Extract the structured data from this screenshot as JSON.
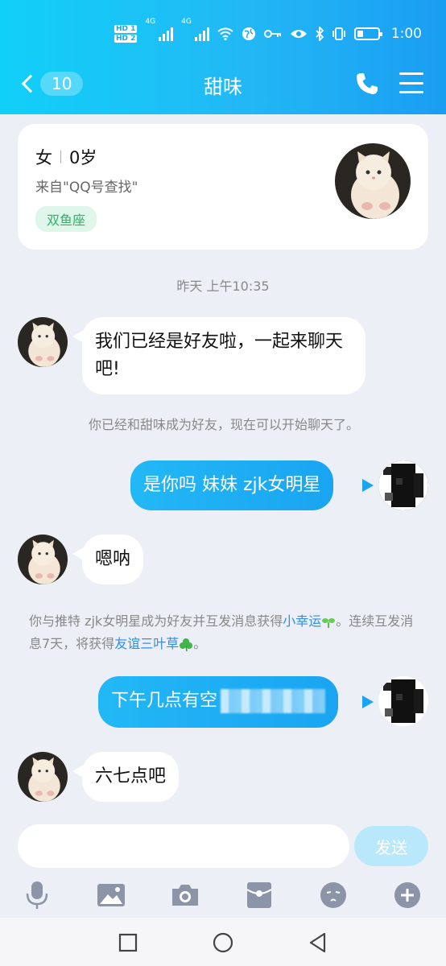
{
  "statusbar": {
    "hd1": "HD 1",
    "hd2": "HD 2",
    "net1": "4G",
    "net2": "4G",
    "time": "1:00"
  },
  "header": {
    "back_count": "10",
    "title": "甜味"
  },
  "profile": {
    "gender": "女",
    "age": "0岁",
    "source": "来自\"QQ号查找\"",
    "tag": "双鱼座"
  },
  "chat": {
    "timestamp": "昨天 上午10:35",
    "msg1": "我们已经是好友啦，一起来聊天吧!",
    "sys1": "你已经和甜味成为好友，现在可以开始聊天了。",
    "msg2": "是你吗 妹妹 zjk女明星",
    "msg3": "嗯呐",
    "sys2_a": "你与推特 zjk女明星成为好友并互发消息获得",
    "sys2_link1": "小幸运",
    "sys2_b": "。连续互发消息7天，将获得",
    "sys2_link2": "友谊三叶草",
    "sys2_c": "。",
    "msg4": "下午几点有空",
    "msg5": "六七点吧"
  },
  "input": {
    "placeholder": "",
    "send_label": "发送"
  },
  "colors": {
    "accent": "#1aa4f2",
    "tag_bg": "#dff6ea",
    "tag_text": "#2fb36a",
    "link": "#2f8ee8"
  },
  "toolbar_icons": [
    "mic-icon",
    "image-icon",
    "camera-icon",
    "red-packet-icon",
    "emoji-icon",
    "plus-icon"
  ]
}
